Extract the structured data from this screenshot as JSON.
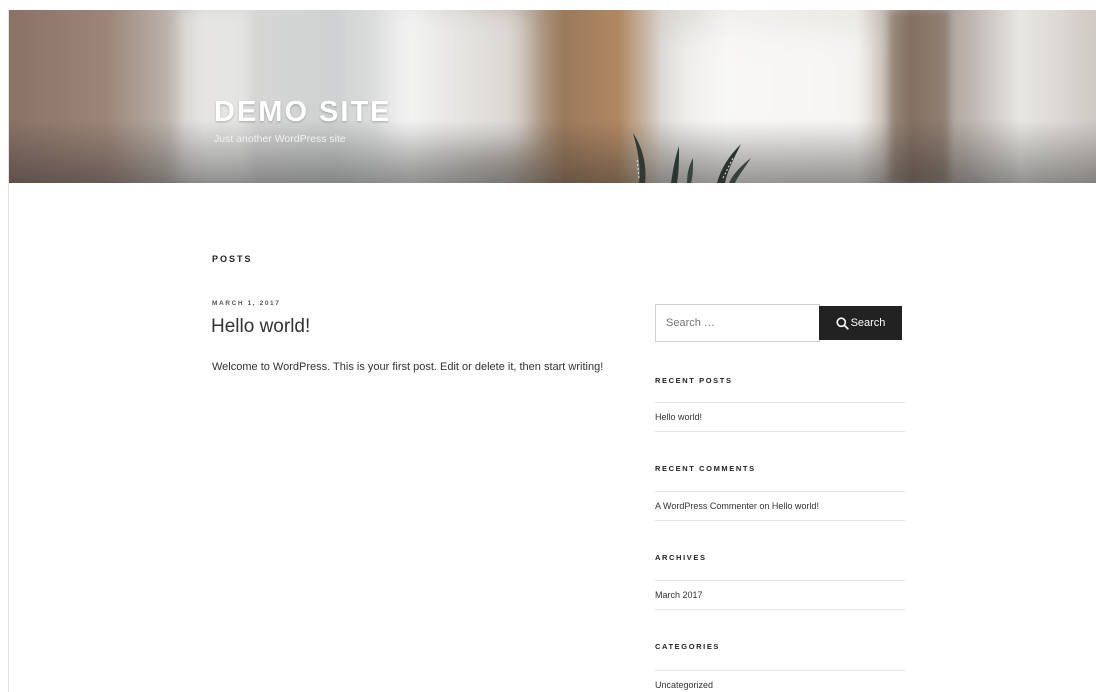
{
  "site": {
    "title": "DEMO SITE",
    "description": "Just another WordPress site"
  },
  "content": {
    "section_label": "POSTS",
    "post": {
      "date": "MARCH 1, 2017",
      "title": "Hello world!",
      "excerpt": "Welcome to WordPress. This is your first post. Edit or delete it, then start writing!"
    }
  },
  "sidebar": {
    "search": {
      "placeholder": "Search …",
      "button_label": "Search",
      "icon": "search-icon"
    },
    "recent_posts": {
      "title": "RECENT POSTS",
      "items": [
        "Hello world!"
      ]
    },
    "recent_comments": {
      "title": "RECENT COMMENTS",
      "author": "A WordPress Commenter",
      "connector": "on",
      "post_link": "Hello world!"
    },
    "archives": {
      "title": "ARCHIVES",
      "items": [
        "March 2017"
      ]
    },
    "categories": {
      "title": "CATEGORIES",
      "items": [
        "Uncategorized"
      ]
    }
  },
  "colors": {
    "button_bg": "#222222",
    "text": "#333333"
  }
}
